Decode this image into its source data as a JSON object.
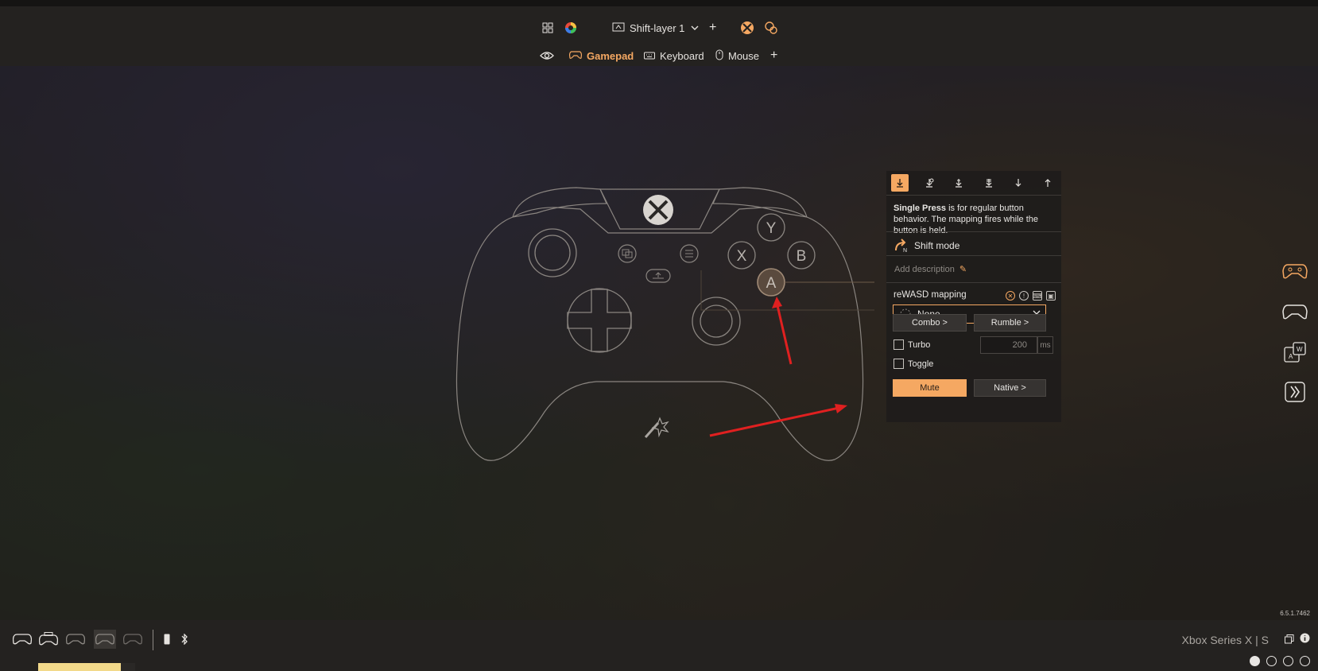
{
  "app": {
    "version": "6.5.1.7462",
    "accent_color": "#f5a862"
  },
  "topbar": {
    "layer_label": "Shift-layer 1",
    "icons": [
      "grid-icon",
      "color-wheel-icon",
      "layer-icon",
      "chevron-down-icon",
      "plus-icon",
      "xbox-logo-icon",
      "gamepad-settings-icon"
    ],
    "tabs": [
      {
        "label": "Gamepad",
        "icon": "gamepad-icon",
        "active": true
      },
      {
        "label": "Keyboard",
        "icon": "keyboard-icon",
        "active": false
      },
      {
        "label": "Mouse",
        "icon": "mouse-icon",
        "active": false
      }
    ]
  },
  "controller": {
    "buttons": [
      "Y",
      "X",
      "B",
      "A"
    ],
    "selected_button": "A"
  },
  "panel": {
    "modes": [
      "single-press-icon",
      "long-press-icon",
      "double-press-icon",
      "triple-press-icon",
      "start-press-icon",
      "release-press-icon"
    ],
    "desc_bold": "Single Press",
    "desc_rest": " is for regular button behavior. The mapping fires while the button is held.",
    "shift_mode": "Shift mode",
    "add_description": "Add description",
    "mapping_title": "reWASD mapping",
    "mapping_value": "None",
    "combo": "Combo >",
    "rumble": "Rumble >",
    "turbo": "Turbo",
    "toggle": "Toggle",
    "turbo_value": "200",
    "turbo_unit": "ms",
    "mute": "Mute",
    "native": "Native >"
  },
  "bottombar": {
    "device_name": "Xbox Series X | S",
    "slots": 4
  }
}
